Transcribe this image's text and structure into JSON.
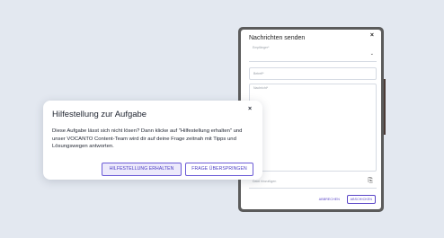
{
  "compose": {
    "title": "Nachrichten senden",
    "close_icon": "×",
    "recipient_label": "Empfänger*",
    "subject_label": "Betreff*",
    "message_label": "Nachricht*",
    "attachment_label": "Datei hinzufügen",
    "cancel_label": "ABBRECHEN",
    "send_label": "ABSCHICKEN"
  },
  "help_dialog": {
    "title": "Hilfestellung zur Aufgabe",
    "close_icon": "×",
    "body": "Diese Aufgabe lässt sich nicht lösen? Dann klicke auf \"Hilfestellung erhalten\" und unser VOCANTO Content-Team wird dir auf deine Frage zeitnah mit Tipps und Lösungswegen antworten.",
    "get_help_label": "HILFESTELLUNG ERHALTEN",
    "skip_label": "FRAGE ÜBERSPRINGEN"
  },
  "colors": {
    "background": "#e3e8f0",
    "accent": "#5a45c7",
    "window_frame": "#5b5b5b"
  },
  "icons": {
    "close": "close-icon",
    "dropdown": "chevron-down-icon",
    "attachment": "paperclip-icon"
  }
}
